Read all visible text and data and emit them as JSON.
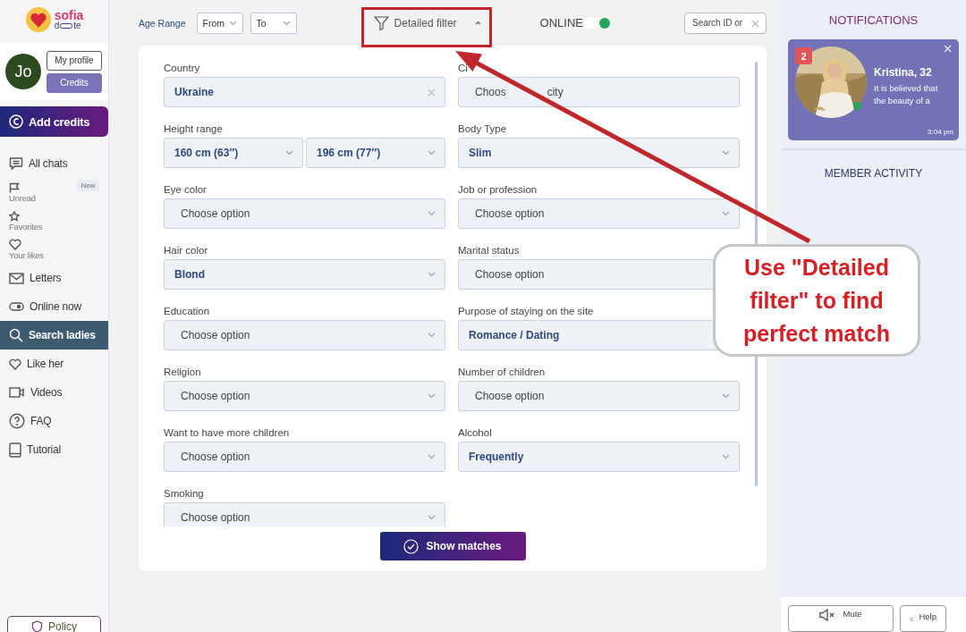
{
  "logo": {
    "top": "sofia",
    "left": "d",
    "right": "te"
  },
  "profile": {
    "initials": "Jo",
    "profile_button": "My profile",
    "credits_button": "Credits"
  },
  "add_credits": "Add credits",
  "nav": [
    {
      "kind": "main",
      "label": "All chats",
      "selected": false
    },
    {
      "kind": "sub",
      "label": "Unread",
      "badge": "New",
      "selected": false
    },
    {
      "kind": "sub",
      "label": "Favorites",
      "selected": false
    },
    {
      "kind": "sub",
      "label": "Your likes",
      "selected": false
    },
    {
      "kind": "main",
      "label": "Letters",
      "selected": false
    },
    {
      "kind": "main",
      "label": "Online now",
      "selected": false
    },
    {
      "kind": "main",
      "label": "Search ladies",
      "selected": true
    },
    {
      "kind": "main",
      "label": "Like her",
      "selected": false
    },
    {
      "kind": "main",
      "label": "Videos",
      "selected": false
    },
    {
      "kind": "main",
      "label": "FAQ",
      "selected": false
    },
    {
      "kind": "main",
      "label": "Tutorial",
      "selected": false
    }
  ],
  "policy_button": "Policy",
  "top_bar": {
    "age_label": "Age Range",
    "age_from": "From",
    "age_to": "To",
    "filter_button": "Detailed filter",
    "filter_expanded": true,
    "online_label": "ONLINE",
    "online_on": true,
    "search_placeholder": "Search ID or"
  },
  "filters": [
    {
      "label": "Country",
      "selects": [
        {
          "kind": "clearable",
          "text": "Ukraine",
          "filled": true
        }
      ]
    },
    {
      "label": "Ci",
      "selects": [
        {
          "kind": "text",
          "parts": [
            "Choos",
            "city"
          ],
          "filled": false
        }
      ]
    },
    {
      "label": "Height range",
      "selects": [
        {
          "text": "160 cm (63″)",
          "filled": true
        },
        {
          "text": "196 cm (77″)",
          "filled": true
        }
      ]
    },
    {
      "label": "Body Type",
      "selects": [
        {
          "text": "Slim",
          "filled": true
        }
      ]
    },
    {
      "label": "Eye color",
      "selects": [
        {
          "text": "Choose option",
          "filled": false
        }
      ]
    },
    {
      "label": "Job or profession",
      "selects": [
        {
          "text": "Choose option",
          "filled": false
        }
      ]
    },
    {
      "label": "Hair color",
      "selects": [
        {
          "text": "Blond",
          "filled": true
        }
      ]
    },
    {
      "label": "Marital status",
      "selects": [
        {
          "text": "Choose option",
          "filled": false
        }
      ]
    },
    {
      "label": "Education",
      "selects": [
        {
          "text": "Choose option",
          "filled": false
        }
      ]
    },
    {
      "label": "Purpose of staying on the site",
      "selects": [
        {
          "text": "Romance / Dating",
          "filled": true
        }
      ]
    },
    {
      "label": "Religion",
      "selects": [
        {
          "text": "Choose option",
          "filled": false
        }
      ]
    },
    {
      "label": "Number of children",
      "selects": [
        {
          "text": "Choose option",
          "filled": false
        }
      ]
    },
    {
      "label": "Want to have more children",
      "selects": [
        {
          "text": "Choose option",
          "filled": false
        }
      ]
    },
    {
      "label": "Alcohol",
      "selects": [
        {
          "text": "Frequently",
          "filled": true
        }
      ]
    },
    {
      "label": "Smoking",
      "selects": [
        {
          "text": "Choose option",
          "filled": false
        }
      ]
    }
  ],
  "show_matches": "Show matches",
  "notifications": {
    "title": "NOTIFICATIONS",
    "card": {
      "badge": "2",
      "name": "Kristina, 32",
      "text": "It is believed that the beauty of a",
      "time": "3:04 pm",
      "online": true
    }
  },
  "member_activity": "MEMBER ACTIVITY",
  "footer_buttons": [
    "Mute",
    "Help"
  ],
  "callout": "Use \"Detailed filter\" to find perfect match"
}
